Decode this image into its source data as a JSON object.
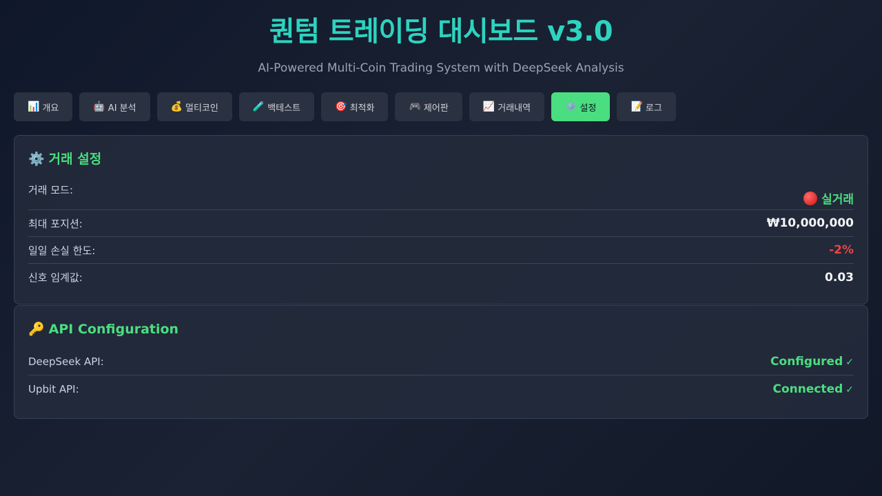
{
  "header": {
    "title": "퀀텀 트레이딩 대시보드 v3.0",
    "subtitle": "AI-Powered Multi-Coin Trading System with DeepSeek Analysis"
  },
  "tabs": [
    {
      "icon": "📊",
      "label": "개요"
    },
    {
      "icon": "🤖",
      "label": "AI 분석"
    },
    {
      "icon": "💰",
      "label": "멀티코인"
    },
    {
      "icon": "🧪",
      "label": "백테스트"
    },
    {
      "icon": "🎯",
      "label": "최적화"
    },
    {
      "icon": "🎮",
      "label": "제어판"
    },
    {
      "icon": "📈",
      "label": "거래내역"
    },
    {
      "icon": "⚙️",
      "label": "설정"
    },
    {
      "icon": "📝",
      "label": "로그"
    }
  ],
  "active_tab": "설정",
  "trading_settings": {
    "icon": "⚙️",
    "title": "거래 설정",
    "rows": [
      {
        "label": "거래 모드:",
        "value": "실거래"
      },
      {
        "label": "최대 포지션:",
        "value": "₩10,000,000"
      },
      {
        "label": "일일 손실 한도:",
        "value": "-2%"
      },
      {
        "label": "신호 임계값:",
        "value": "0.03"
      }
    ]
  },
  "api_config": {
    "icon": "🔑",
    "title": "API Configuration",
    "rows": [
      {
        "label": "DeepSeek API:",
        "value": "Configured",
        "check": "✓"
      },
      {
        "label": "Upbit API:",
        "value": "Connected",
        "check": "✓"
      }
    ]
  },
  "colors": {
    "accent_teal": "#2dd4bf",
    "accent_green": "#4ade80",
    "danger_red": "#ef4444"
  }
}
